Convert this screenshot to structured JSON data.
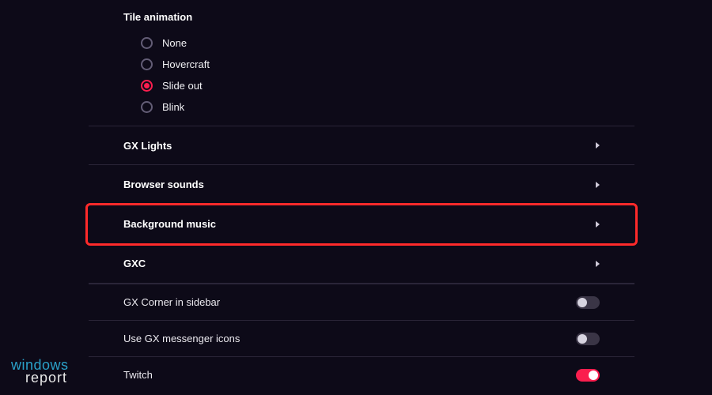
{
  "tile_animation": {
    "title": "Tile animation",
    "options": [
      "None",
      "Hovercraft",
      "Slide out",
      "Blink"
    ],
    "selected_index": 2
  },
  "expand_rows": [
    {
      "label": "GX Lights"
    },
    {
      "label": "Browser sounds"
    },
    {
      "label": "Background music",
      "highlighted": true
    },
    {
      "label": "GXC"
    }
  ],
  "toggle_rows": [
    {
      "label": "GX Corner in sidebar",
      "on": false
    },
    {
      "label": "Use GX messenger icons",
      "on": false
    },
    {
      "label": "Twitch",
      "on": true
    }
  ],
  "watermark": {
    "line1": "windows",
    "line2": "report"
  }
}
